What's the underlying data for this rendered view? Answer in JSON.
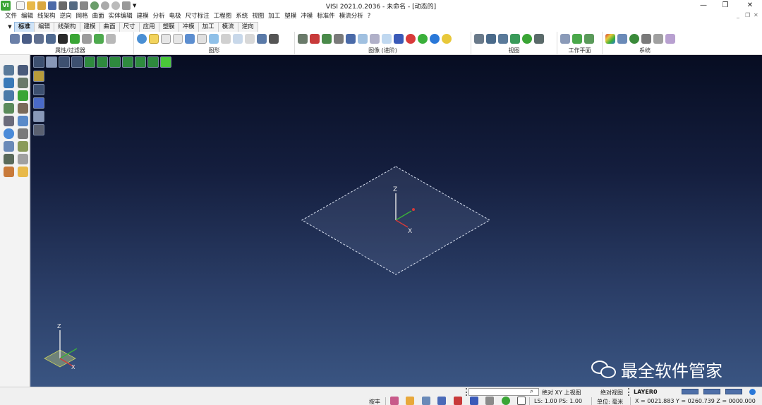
{
  "window": {
    "app_logo": "VI",
    "title": "VISI 2021.0.2036 - 未命名 - [动态的]",
    "minimize": "—",
    "restore": "❐",
    "close": "✕",
    "mdi_min": "_",
    "mdi_restore": "❐",
    "mdi_close": "✕"
  },
  "menu": [
    "文件",
    "编辑",
    "线架构",
    "逆向",
    "网格",
    "曲面",
    "实体编辑",
    "建模",
    "分析",
    "电极",
    "尺寸标注",
    "工程图",
    "系统",
    "视图",
    "加工",
    "塑模",
    "冲模",
    "标准件",
    "模流分析",
    "?"
  ],
  "tabs": [
    "标准",
    "编辑",
    "线架构",
    "建模",
    "曲面",
    "尺寸",
    "应用",
    "塑膜",
    "冲模",
    "加工",
    "模流",
    "逆向"
  ],
  "ribbon_groups": [
    "属性/过滤器",
    "图形",
    "图像 (进阶)",
    "视图",
    "工作平面",
    "系统"
  ],
  "viewport": {
    "axis_labels": {
      "z": "Z",
      "x": "X"
    },
    "triad_labels": {
      "z": "Z",
      "x": "X"
    },
    "watermark": "最全软件管家"
  },
  "status": {
    "view_name": "绝对 XY 上视图",
    "mode": "按丰",
    "view_mode": "绝对视图",
    "layer": "LAYER0",
    "ls_ps": "LS: 1.00 PS: 1.00",
    "unit": "单位: 毫米",
    "coords": "X = 0021.883 Y = 0260.739 Z = 0000.000"
  },
  "colors": {
    "accent": "#3aa535",
    "tab_active": "#cfe3f7",
    "viewport_top": "#070d22",
    "viewport_bottom": "#3a5582",
    "axis_x": "#d43a3a",
    "axis_y": "#3ab03a",
    "axis_z": "#e8e8e8"
  }
}
